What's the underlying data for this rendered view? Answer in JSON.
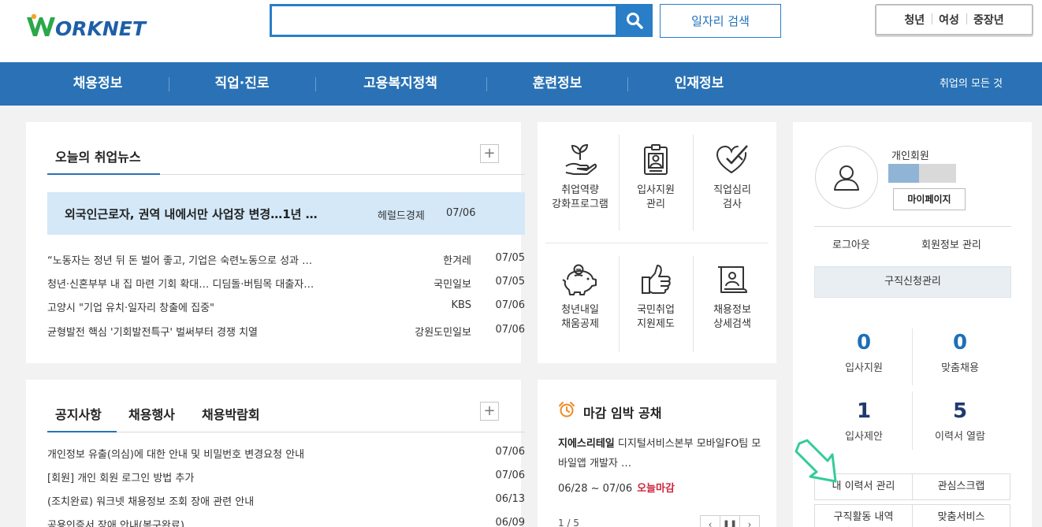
{
  "brand": {
    "logo_text": "ORKNET",
    "logo_letter": "W",
    "color_primary": "#2a72b5",
    "color_green": "#2aa84a"
  },
  "search": {
    "placeholder": "",
    "value": "",
    "job_search_label": "일자리 검색"
  },
  "target_tabs": [
    "청년",
    "여성",
    "중장년"
  ],
  "nav": {
    "items": [
      "채용정보",
      "직업·진로",
      "고용복지정책",
      "훈련정보",
      "인재정보"
    ],
    "right_link": "취업의 모든 것"
  },
  "news": {
    "title": "오늘의 취업뉴스",
    "headline": {
      "text": "외국인근로자, 권역 내에서만 사업장 변경…1년 …",
      "source": "헤럴드경제",
      "date": "07/06"
    },
    "items": [
      {
        "text": "“노동자는 정년 뒤 돈 벌어 좋고, 기업은 숙련노동으로 성과 …",
        "source": "한겨레",
        "date": "07/05"
      },
      {
        "text": "청년·신혼부부 내 집 마련 기회 확대… 디딤돌·버팀목 대출자…",
        "source": "국민일보",
        "date": "07/05"
      },
      {
        "text": "고양시 \"기업 유치·일자리 창출에 집중\"",
        "source": "KBS",
        "date": "07/06"
      },
      {
        "text": "균형발전 핵심 '기회발전특구' 벌써부터 경쟁 치열",
        "source": "강원도민일보",
        "date": "07/06"
      }
    ]
  },
  "services": [
    {
      "label": "취업역량\n강화프로그램",
      "icon": "sprout-hand-icon"
    },
    {
      "label": "입사지원\n관리",
      "icon": "id-badge-icon"
    },
    {
      "label": "직업심리\n검사",
      "icon": "heart-check-icon"
    },
    {
      "label": "청년내일\n채움공제",
      "icon": "piggy-bank-icon"
    },
    {
      "label": "국민취업\n지원제도",
      "icon": "thumbs-up-icon"
    },
    {
      "label": "채용정보\n상세검색",
      "icon": "profile-scroll-icon"
    }
  ],
  "notices": {
    "tabs": [
      "공지사항",
      "채용행사",
      "채용박람회"
    ],
    "items": [
      {
        "text": "개인정보 유출(의심)에 대한 안내 및 비밀번호 변경요청 안내",
        "date": "07/06"
      },
      {
        "text": "[회원] 개인 회원 로그인 방법 추가",
        "date": "07/06"
      },
      {
        "text": "(조치완료) 워크넷 채용정보 조회 장애 관련 안내",
        "date": "06/13"
      },
      {
        "text": "공용인증서 장애 안내(복구완료)",
        "date": "06/09"
      }
    ]
  },
  "deadline": {
    "title": "마감 임박 공채",
    "company": "지에스리테일",
    "job": "디지털서비스본부 모바일FO팀 모바일앱 개발자 …",
    "period": "06/28 ~ 07/06",
    "badge": "오늘마감",
    "pager": "1 / 5"
  },
  "member": {
    "type": "개인회원",
    "level_fraction": 0.45,
    "mypage": "마이페이지",
    "logout": "로그아웃",
    "info": "회원정보 관리",
    "apply_manage": "구직신청관리",
    "stats": [
      {
        "num": "0",
        "label": "입사지원",
        "color": "#1e6fb8"
      },
      {
        "num": "0",
        "label": "맞춤채용",
        "color": "#1e6fb8"
      },
      {
        "num": "1",
        "label": "입사제안",
        "color": "#1f3a6e"
      },
      {
        "num": "5",
        "label": "이력서 열람",
        "color": "#1f3a6e"
      }
    ],
    "links": [
      "내 이력서 관리",
      "관심스크랩",
      "구직활동 내역",
      "맞춤서비스"
    ]
  }
}
